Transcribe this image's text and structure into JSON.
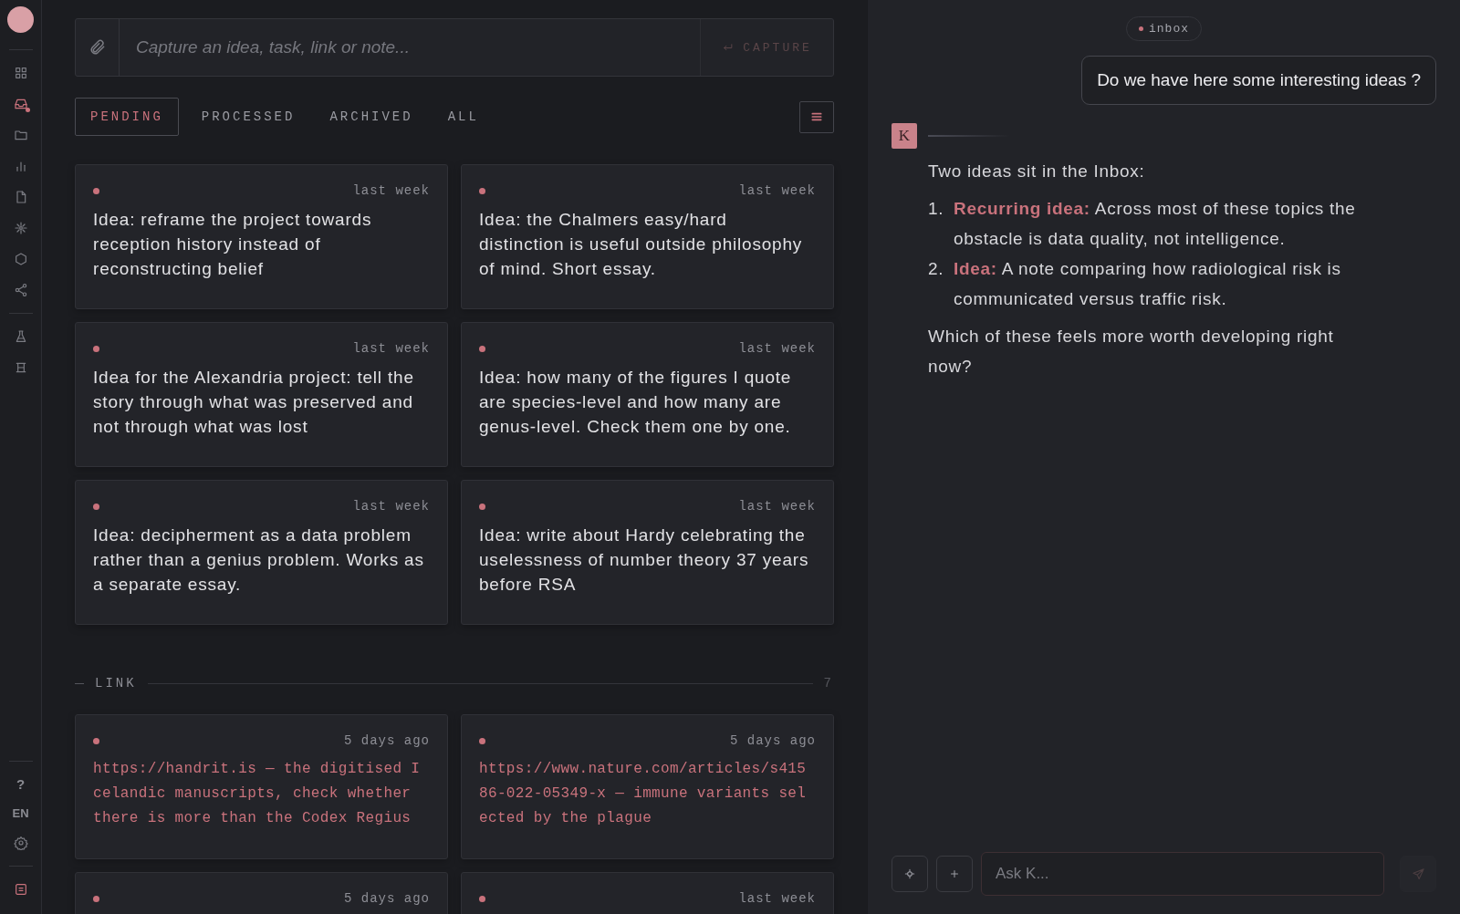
{
  "sidebar": {
    "nav_items": [
      {
        "selected": false
      },
      {
        "selected": true,
        "unread": true
      },
      {
        "selected": false
      },
      {
        "selected": false
      },
      {
        "selected": false
      },
      {
        "selected": false
      },
      {
        "selected": false
      },
      {
        "selected": false
      }
    ],
    "tool_items": [
      {
        "selected": false
      },
      {
        "selected": false
      }
    ],
    "help": "?",
    "language": "EN"
  },
  "capture": {
    "placeholder": "Capture an idea, task, link or note...",
    "button": "CAPTURE"
  },
  "tabs": [
    {
      "label": "PENDING",
      "selected": true
    },
    {
      "label": "PROCESSED",
      "selected": false
    },
    {
      "label": "ARCHIVED",
      "selected": false
    },
    {
      "label": "ALL",
      "selected": false
    }
  ],
  "sections": [
    {
      "cards": [
        {
          "kind": "note",
          "time": "last week",
          "text": "Idea: reframe the project towards reception history instead of reconstructing belief"
        },
        {
          "kind": "note",
          "time": "last week",
          "text": "Idea: the Chalmers easy/hard distinction is useful outside philosophy of mind. Short essay."
        },
        {
          "kind": "note",
          "time": "last week",
          "text": "Idea for the Alexandria project: tell the story through what was preserved and not through what was lost"
        },
        {
          "kind": "note",
          "time": "last week",
          "text": "Idea: how many of the figures I quote are species-level and how many are genus-level. Check them one by one."
        },
        {
          "kind": "note",
          "time": "last week",
          "text": "Idea: decipherment as a data problem rather than a genius problem. Works as a separate essay."
        },
        {
          "kind": "note",
          "time": "last week",
          "text": "Idea: write about Hardy celebrating the uselessness of number theory 37 years before RSA"
        }
      ]
    },
    {
      "title": "LINK",
      "count": "7",
      "cards": [
        {
          "kind": "link",
          "time": "5 days ago",
          "text": "https://handrit.is — the digitised Icelandic manuscripts, check whether there is more than the Codex Regius"
        },
        {
          "kind": "link",
          "time": "5 days ago",
          "text": "https://www.nature.com/articles/s41586-022-05349-x — immune variants selected by the plague"
        },
        {
          "kind": "link",
          "time": "5 days ago"
        },
        {
          "kind": "link",
          "time": "last week"
        }
      ]
    }
  ],
  "chat": {
    "context": "inbox",
    "messages": [
      {
        "kind": "user",
        "text": "Do we have here some interesting ideas ?"
      },
      {
        "kind": "assistant",
        "avatar": "K",
        "intro": "Two ideas sit in the Inbox:",
        "items": [
          {
            "number": "1.",
            "label": "Recurring idea:",
            "text": "Across most of these topics the obstacle is data quality, not intelligence."
          },
          {
            "number": "2.",
            "label": "Idea:",
            "text": "A note comparing how radiological risk is communicated versus traffic risk."
          }
        ],
        "closing": "Which of these feels more worth developing right now?"
      }
    ],
    "composer": {
      "placeholder": "Ask K..."
    }
  }
}
